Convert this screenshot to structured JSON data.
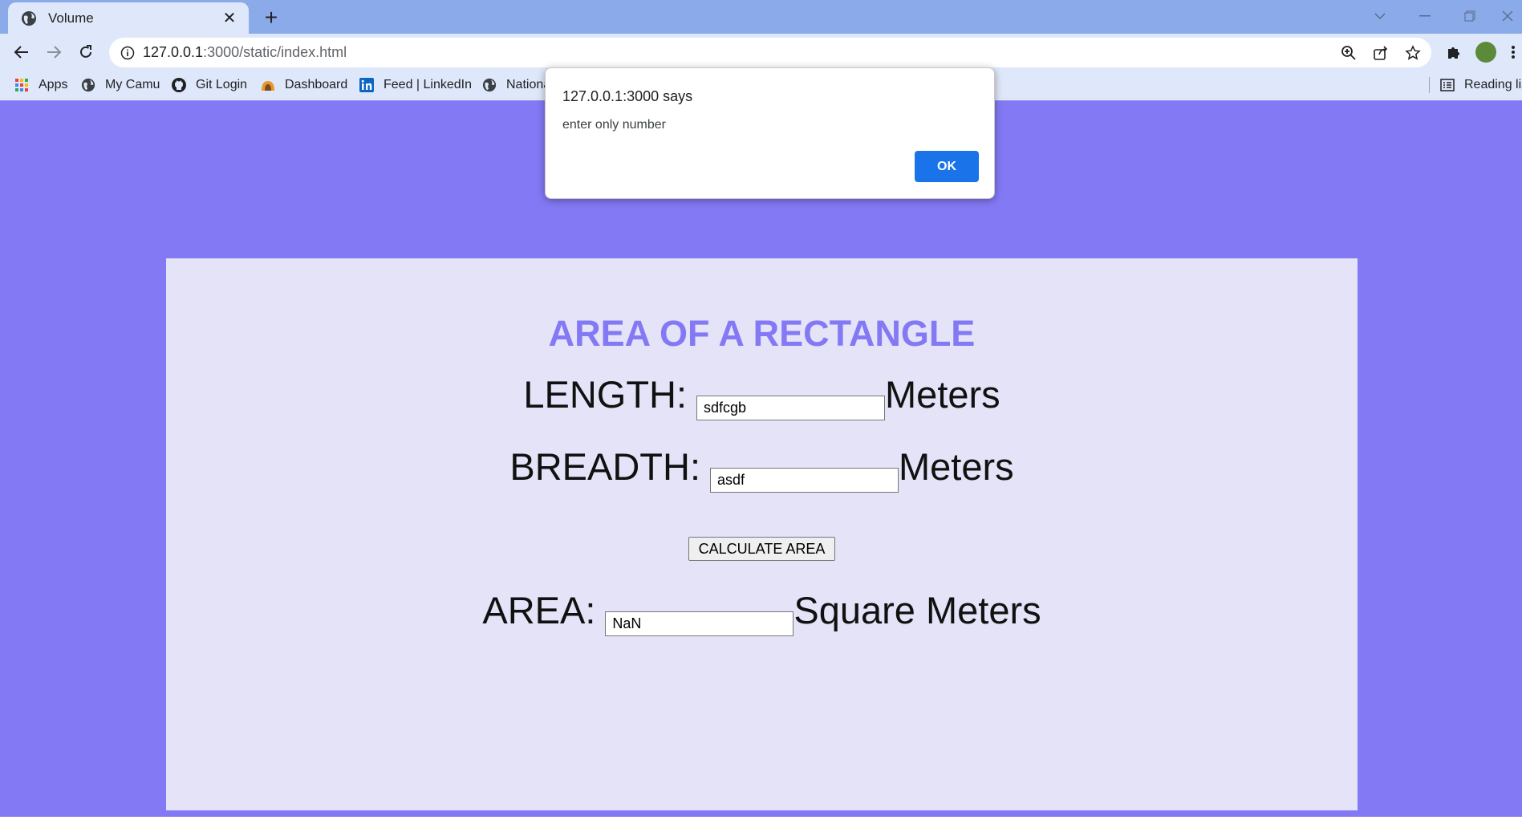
{
  "browser": {
    "tab": {
      "title": "Volume",
      "close_glyph": "✕"
    },
    "new_tab_glyph": "+",
    "address": {
      "host": "127.0.0.1",
      "rest": ":3000/static/index.html"
    },
    "bookmarks": [
      {
        "label": "Apps",
        "icon": "apps-grid-icon"
      },
      {
        "label": "My Camu",
        "icon": "globe-icon"
      },
      {
        "label": "Git Login",
        "icon": "github-icon"
      },
      {
        "label": "Dashboard",
        "icon": "dashboard-icon"
      },
      {
        "label": "Feed | LinkedIn",
        "icon": "linkedin-icon"
      },
      {
        "label": "Nationa",
        "icon": "globe-icon"
      }
    ],
    "reading_list": "Reading lis"
  },
  "page": {
    "heading": "AREA OF A RECTANGLE",
    "length": {
      "label": "LENGTH:",
      "value": "sdfcgb",
      "unit": "Meters"
    },
    "breadth": {
      "label": "BREADTH:",
      "value": "asdf",
      "unit": "Meters"
    },
    "calculate_button": "CALCULATE AREA",
    "area": {
      "label": "AREA:",
      "value": "NaN",
      "unit": "Square Meters"
    }
  },
  "dialog": {
    "title": "127.0.0.1:3000 says",
    "message": "enter only number",
    "ok_label": "OK"
  },
  "colors": {
    "page_background": "#8479f5",
    "card_background": "#e4e3f8",
    "heading": "#8479f5",
    "dialog_button": "#1a73e8"
  }
}
